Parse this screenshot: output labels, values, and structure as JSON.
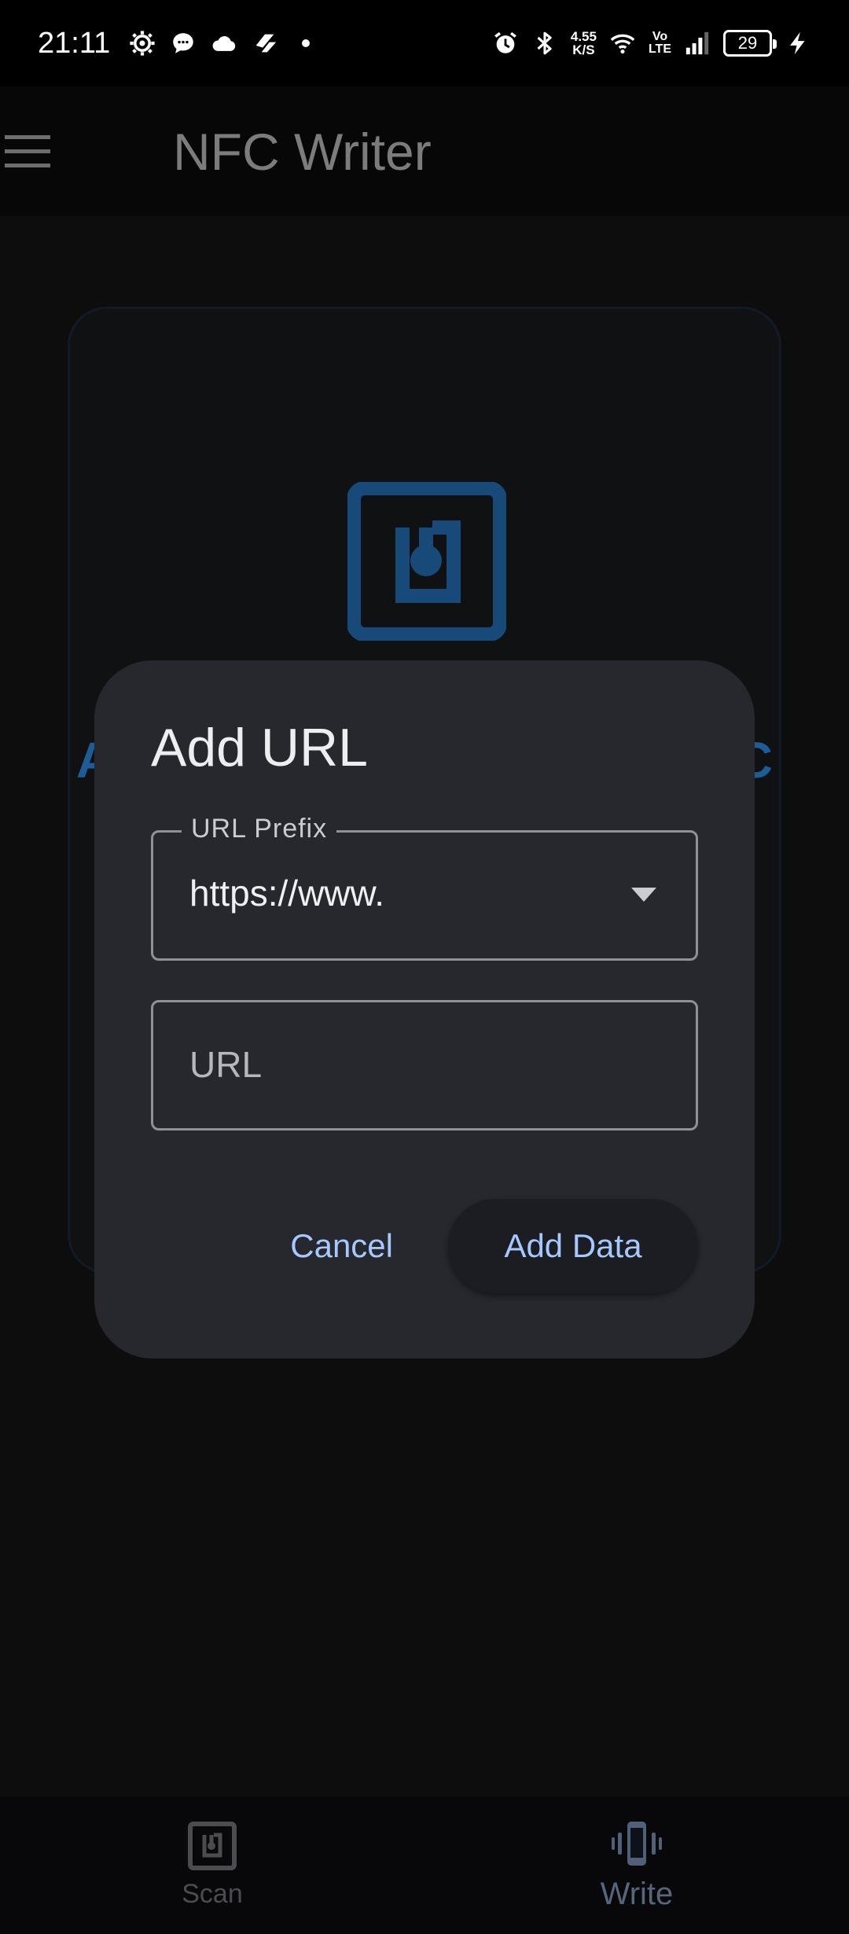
{
  "status_bar": {
    "time": "21:11",
    "net_speed_value": "4.55",
    "net_speed_unit": "K/S",
    "volte_top": "Vo",
    "volte_bottom": "LTE",
    "battery": "29"
  },
  "app_bar": {
    "title": "NFC Writer",
    "menu_icon": "hamburger-menu-icon"
  },
  "card": {
    "text_left": "A",
    "text_right": "C",
    "icon": "nfc-tag-icon"
  },
  "dialog": {
    "title": "Add URL",
    "prefix_field": {
      "label": "URL Prefix",
      "value": "https://www."
    },
    "url_field": {
      "placeholder": "URL",
      "value": ""
    },
    "cancel_label": "Cancel",
    "add_label": "Add Data"
  },
  "bottom_nav": {
    "items": [
      {
        "label": "Scan",
        "icon": "nfc-scan-icon",
        "active": false
      },
      {
        "label": "Write",
        "icon": "phone-vibrate-icon",
        "active": true
      }
    ]
  },
  "colors": {
    "accent": "#a5c8ff",
    "nfc_blue": "#1e5c96",
    "dialog_bg": "#26282d"
  }
}
